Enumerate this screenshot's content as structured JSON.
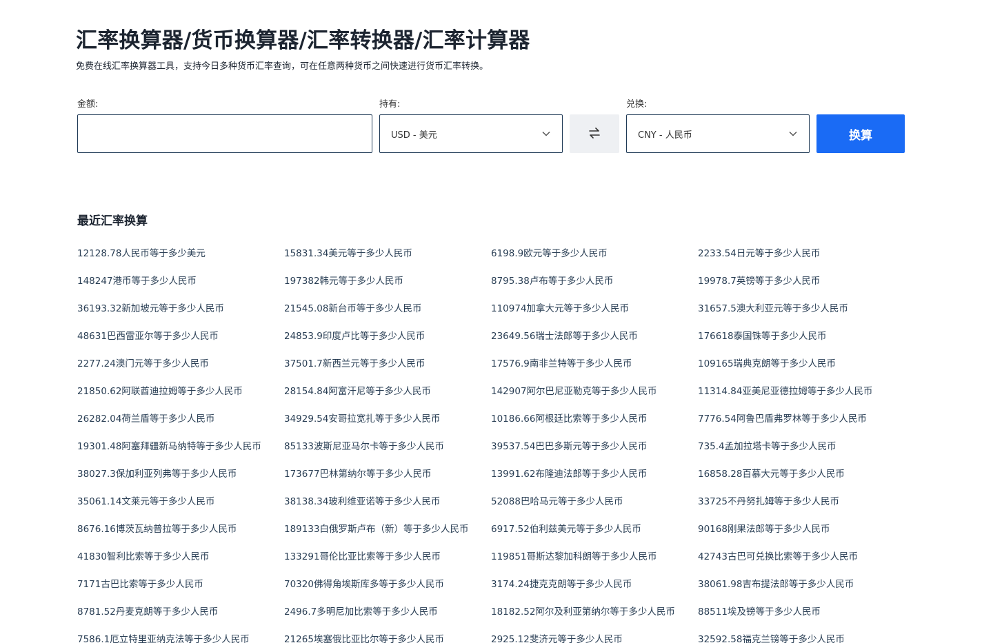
{
  "header": {
    "title": "汇率换算器/货币换算器/汇率转换器/汇率计算器",
    "subtitle": "免费在线汇率换算器工具，支持今日多种货币汇率查询，可在任意两种货币之间快速进行货币汇率转换。"
  },
  "form": {
    "amount_label": "金额:",
    "amount_value": "",
    "from_label": "持有:",
    "from_value": "USD - 美元",
    "to_label": "兑换:",
    "to_value": "CNY - 人民币",
    "convert_label": "换算"
  },
  "icons": {
    "swap": "swap-arrows-icon",
    "dropdown": "chevron-down-icon"
  },
  "colors": {
    "accent": "#1a6bf5",
    "border": "#1f3a56",
    "swap_bg": "#eef0f3"
  },
  "recent": {
    "title": "最近汇率换算",
    "links": [
      "12128.78人民币等于多少美元",
      "15831.34美元等于多少人民币",
      "6198.9欧元等于多少人民币",
      "2233.54日元等于多少人民币",
      "148247港币等于多少人民币",
      "197382韩元等于多少人民币",
      "8795.38卢布等于多少人民币",
      "19978.7英镑等于多少人民币",
      "36193.32新加坡元等于多少人民币",
      "21545.08新台币等于多少人民币",
      "110974加拿大元等于多少人民币",
      "31657.5澳大利亚元等于多少人民币",
      "48631巴西雷亚尔等于多少人民币",
      "24853.9印度卢比等于多少人民币",
      "23649.56瑞士法郎等于多少人民币",
      "176618泰国铢等于多少人民币",
      "2277.24澳门元等于多少人民币",
      "37501.7新西兰元等于多少人民币",
      "17576.9南非兰特等于多少人民币",
      "109165瑞典克朗等于多少人民币",
      "21850.62阿联酋迪拉姆等于多少人民币",
      "28154.84阿富汗尼等于多少人民币",
      "142907阿尔巴尼亚勒克等于多少人民币",
      "11314.84亚美尼亚德拉姆等于多少人民币",
      "26282.04荷兰盾等于多少人民币",
      "34929.54安哥拉宽扎等于多少人民币",
      "10186.66阿根廷比索等于多少人民币",
      "7776.54阿鲁巴盾弗罗林等于多少人民币",
      "19301.48阿塞拜疆新马纳特等于多少人民币",
      "85133波斯尼亚马尔卡等于多少人民币",
      "39537.54巴巴多斯元等于多少人民币",
      "735.4孟加拉塔卡等于多少人民币",
      "38027.3保加利亚列弗等于多少人民币",
      "173677巴林第纳尔等于多少人民币",
      "13991.62布隆迪法郎等于多少人民币",
      "16858.28百慕大元等于多少人民币",
      "35061.14文莱元等于多少人民币",
      "38138.34玻利维亚诺等于多少人民币",
      "52088巴哈马元等于多少人民币",
      "33725不丹努扎姆等于多少人民币",
      "8676.16博茨瓦纳普拉等于多少人民币",
      "189133白俄罗斯卢布（新）等于多少人民币",
      "6917.52伯利兹美元等于多少人民币",
      "90168刚果法郎等于多少人民币",
      "41830智利比索等于多少人民币",
      "133291哥伦比亚比索等于多少人民币",
      "119851哥斯达黎加科朗等于多少人民币",
      "42743古巴可兑换比索等于多少人民币",
      "7171古巴比索等于多少人民币",
      "70320佛得角埃斯库多等于多少人民币",
      "3174.24捷克克朗等于多少人民币",
      "38061.98吉布提法郎等于多少人民币",
      "8781.52丹麦克朗等于多少人民币",
      "2496.7多明尼加比索等于多少人民币",
      "18182.52阿尔及利亚第纳尔等于多少人民币",
      "88511埃及镑等于多少人民币",
      "7586.1厄立特里亚纳克法等于多少人民币",
      "21265埃塞俄比亚比尔等于多少人民币",
      "2925.12斐济元等于多少人民币",
      "32592.58福克兰镑等于多少人民币"
    ]
  }
}
